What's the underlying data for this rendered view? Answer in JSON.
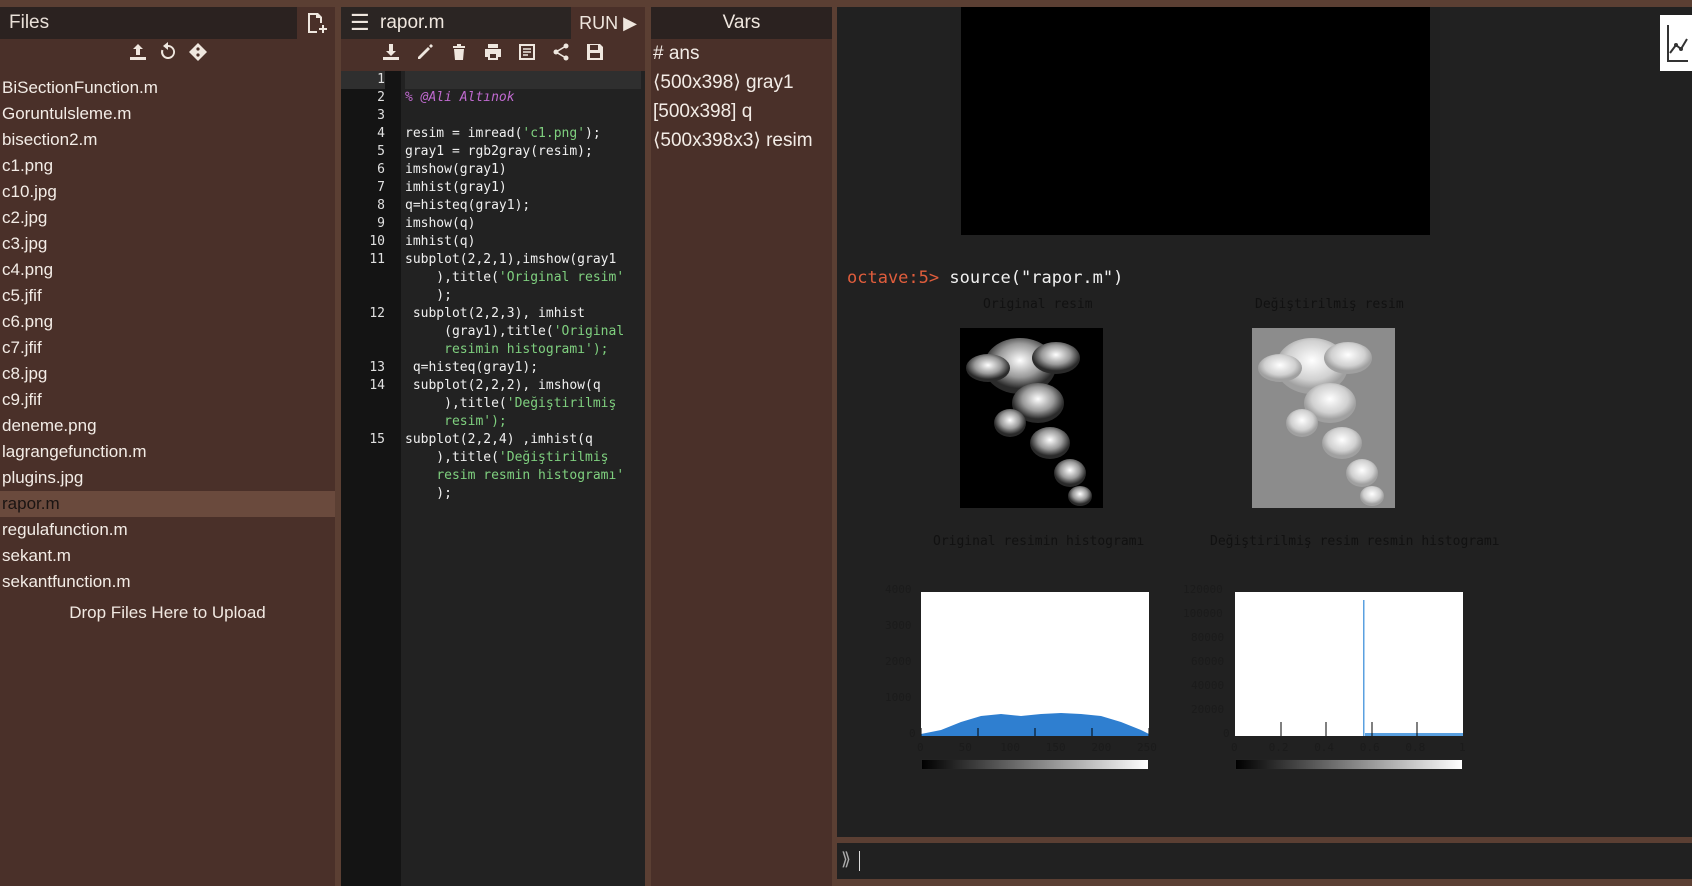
{
  "files": {
    "title": "Files",
    "items": [
      "BiSectionFunction.m",
      "Goruntulsleme.m",
      "bisection2.m",
      "c1.png",
      "c10.jpg",
      "c2.jpg",
      "c3.jpg",
      "c4.png",
      "c5.jfif",
      "c6.png",
      "c7.jfif",
      "c8.jpg",
      "c9.jfif",
      "deneme.png",
      "lagrangefunction.m",
      "plugins.jpg",
      "rapor.m",
      "regulafunction.m",
      "sekant.m",
      "sekantfunction.m"
    ],
    "active": "rapor.m",
    "drop_text": "Drop Files Here to Upload"
  },
  "editor": {
    "filename": "rapor.m",
    "run_label": "RUN ▶",
    "lines": [
      {
        "n": "1",
        "text": [
          ""
        ]
      },
      {
        "n": "2",
        "text": [
          "% @Ali Altınok"
        ]
      },
      {
        "n": "3",
        "text": [
          ""
        ]
      },
      {
        "n": "4",
        "text": [
          "resim = imread('c1.png');"
        ]
      },
      {
        "n": "5",
        "text": [
          "gray1 = rgb2gray(resim);"
        ]
      },
      {
        "n": "6",
        "text": [
          "imshow(gray1)"
        ]
      },
      {
        "n": "7",
        "text": [
          "imhist(gray1)"
        ]
      },
      {
        "n": "8",
        "text": [
          "q=histeq(gray1);"
        ]
      },
      {
        "n": "9",
        "text": [
          "imshow(q)"
        ]
      },
      {
        "n": "10",
        "text": [
          "imhist(q)"
        ]
      },
      {
        "n": "11",
        "text": [
          "subplot(2,2,1),imshow(gray1",
          "    ),title('Original resim'",
          "    );"
        ]
      },
      {
        "n": "12",
        "text": [
          " subplot(2,2,3), imhist",
          "     (gray1),title('Original",
          "     resimin histogramı');"
        ]
      },
      {
        "n": "13",
        "text": [
          " q=histeq(gray1);"
        ]
      },
      {
        "n": "14",
        "text": [
          " subplot(2,2,2), imshow(q",
          "     ),title('Değiştirilmiş",
          "     resim');"
        ]
      },
      {
        "n": "15",
        "text": [
          "subplot(2,2,4) ,imhist(q",
          "    ),title('Değiştirilmiş",
          "    resim resmin histogramı'",
          "    );"
        ]
      }
    ]
  },
  "vars": {
    "title": "Vars",
    "items": [
      "# ans",
      "⟨500x398⟩ gray1",
      "[500x398] q",
      "⟨500x398x3⟩ resim"
    ]
  },
  "output": {
    "prompt": "octave:5>",
    "command": "source(\"rapor.m\")",
    "titles": {
      "tl": "Original resim",
      "tr": "Değiştirilmiş resim",
      "bl": "Original resimin histogramı",
      "br": "Değiştirilmiş resim resmin histogramı"
    },
    "hist_left_yticks": [
      "4000",
      "3000",
      "2000",
      "1000",
      "0"
    ],
    "hist_right_yticks": [
      "120000",
      "100000",
      "80000",
      "60000",
      "40000",
      "20000",
      "0"
    ],
    "hist_left_xticks": [
      "0",
      "50",
      "100",
      "150",
      "200",
      "250"
    ],
    "hist_right_xticks": [
      "0",
      "0.2",
      "0.4",
      "0.6",
      "0.8",
      "1"
    ]
  }
}
